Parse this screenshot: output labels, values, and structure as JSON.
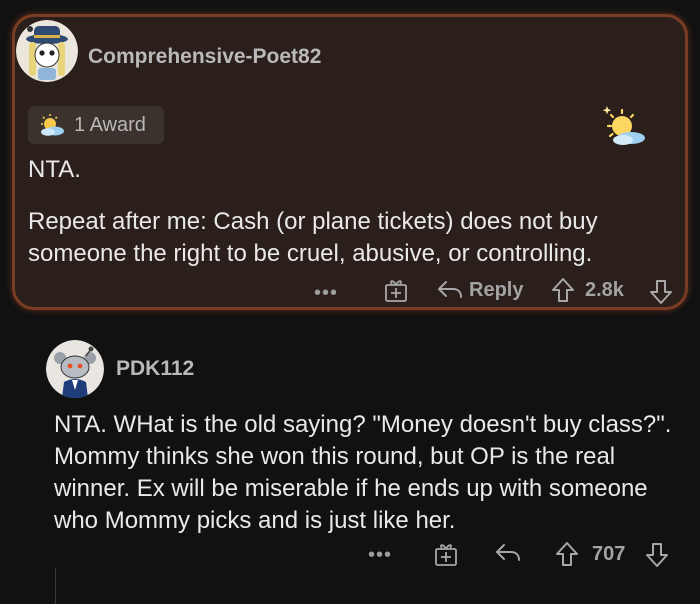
{
  "comment1": {
    "username": "Comprehensive-Poet82",
    "award_label": "1 Award",
    "lines": [
      "NTA.",
      "Repeat after me: Cash (or plane tickets) does not buy someone the right to be cruel, abusive, or controlling."
    ],
    "actions": {
      "more": "•••",
      "reply": "Reply",
      "score": "2.8k"
    }
  },
  "comment2": {
    "username": "PDK112",
    "text": "NTA. WHat is the old saying? \"Money doesn't buy class?\". Mommy thinks she won this round, but OP is the real winner. Ex will be miserable if he ends up with someone who Mommy picks and is just like her.",
    "actions": {
      "more": "•••",
      "score": "707"
    }
  },
  "colors": {
    "card_border": "#7a3c22",
    "card_bg": "#2a1f1b",
    "page_bg": "#111112",
    "text": "#e9e9e9",
    "muted": "#9d9d9d"
  }
}
